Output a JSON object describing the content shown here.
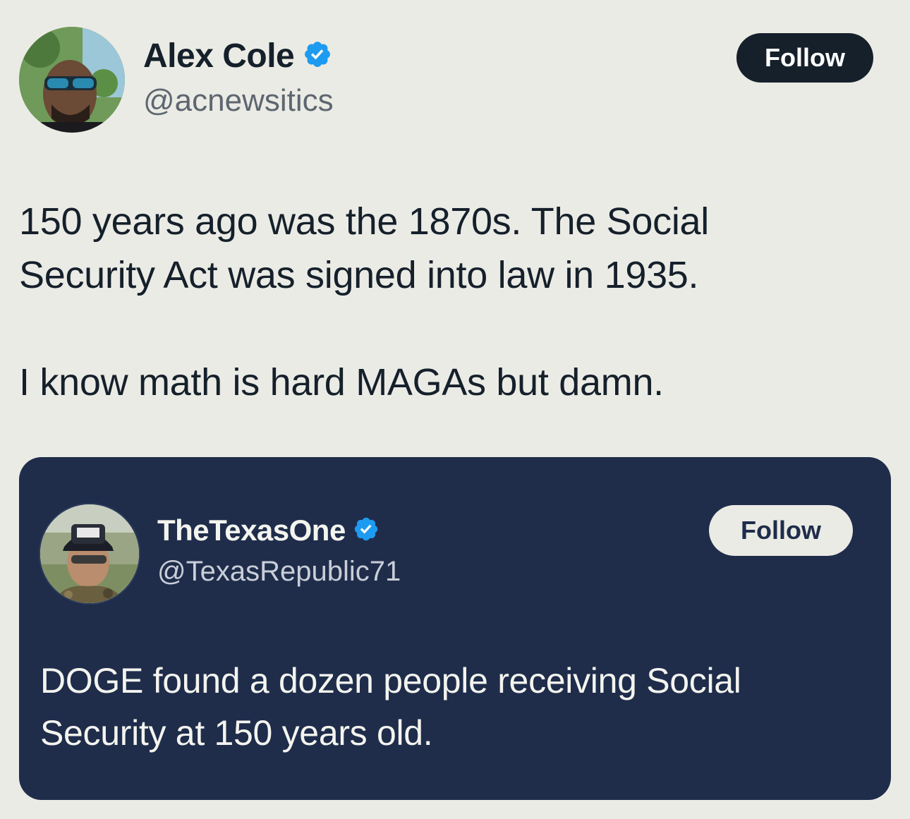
{
  "main_tweet": {
    "author": {
      "display_name": "Alex Cole",
      "handle": "@acnewsitics",
      "verified_icon": "verified-badge-icon"
    },
    "follow_label": "Follow",
    "text_lines": [
      "150 years ago was the 1870s. The Social",
      "Security Act was signed into law in 1935.",
      "I know math is hard MAGAs but damn."
    ]
  },
  "quoted_tweet": {
    "author": {
      "display_name": "TheTexasOne",
      "handle": "@TexasRepublic71",
      "verified_icon": "verified-badge-icon"
    },
    "follow_label": "Follow",
    "text_lines": [
      "DOGE found a dozen people receiving Social",
      "Security at 150 years old."
    ]
  },
  "colors": {
    "background": "#ebebe5",
    "card_background": "#1f2d4b",
    "verified_blue": "#1d9bf0",
    "text_dark": "#15202b"
  }
}
